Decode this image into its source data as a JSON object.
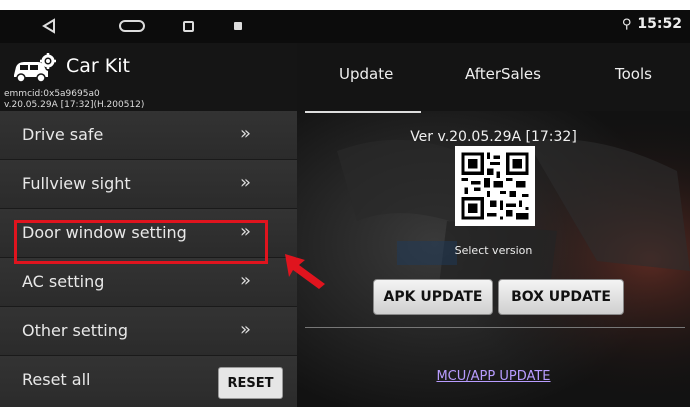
{
  "status_bar": {
    "back_icon": "back-triangle-icon",
    "home_icon": "home-pill-icon",
    "recents_icon": "recents-square-icon",
    "notification_icon": "notification-icon",
    "location_icon": "location-pin-icon",
    "location_glyph": "⚲",
    "time": "15:52"
  },
  "header": {
    "logo_icon": "car-gear-icon",
    "title": "Car Kit",
    "emmcid": "emmcid:0x5a9695a0",
    "version_line": "v.20.05.29A [17:32](H.200512)"
  },
  "menu": {
    "items": [
      {
        "label": "Drive safe",
        "chevron": "»"
      },
      {
        "label": "Fullview sight",
        "chevron": "»"
      },
      {
        "label": "Door window setting",
        "chevron": "»"
      },
      {
        "label": "AC setting",
        "chevron": "»"
      },
      {
        "label": "Other setting",
        "chevron": "»"
      },
      {
        "label": "Reset all"
      }
    ],
    "reset_button": "RESET",
    "highlight_color": "#e0141e"
  },
  "tabs": [
    {
      "label": "Update",
      "active": true
    },
    {
      "label": "AfterSales",
      "active": false
    },
    {
      "label": "Tools",
      "active": false
    }
  ],
  "update_panel": {
    "version": "Ver v.20.05.29A [17:32]",
    "qr_icon": "qr-code",
    "select_version": "Select version",
    "apk_button": "APK UPDATE",
    "box_button": "BOX UPDATE",
    "mcu_link": "MCU/APP UPDATE",
    "link_color": "#b89cff"
  }
}
